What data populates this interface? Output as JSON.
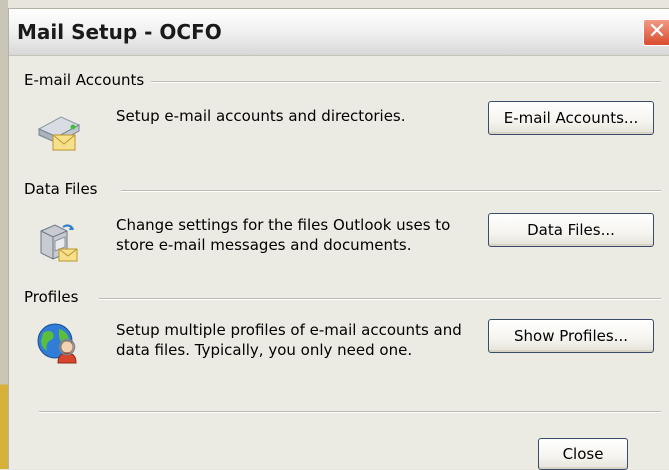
{
  "window": {
    "title": "Mail Setup - OCFO",
    "close_glyph": "✕"
  },
  "sections": {
    "email": {
      "heading": "E-mail Accounts",
      "description": "Setup e-mail accounts and directories.",
      "button": "E-mail Accounts...",
      "icon": "email-accounts-icon"
    },
    "data_files": {
      "heading": "Data Files",
      "description_line1": "Change settings for the files Outlook uses to",
      "description_line2": "store e-mail messages and documents.",
      "button": "Data Files...",
      "icon": "data-files-icon"
    },
    "profiles": {
      "heading": "Profiles",
      "description_line1": "Setup multiple profiles of e-mail accounts and",
      "description_line2": "data files. Typically, you only need one.",
      "button": "Show Profiles...",
      "icon": "profiles-icon"
    }
  },
  "footer": {
    "close_button": "Close"
  },
  "colors": {
    "title_close_red": "#d94c2e",
    "button_border": "#3b4c6b",
    "dialog_bg": "#ecebe3"
  }
}
